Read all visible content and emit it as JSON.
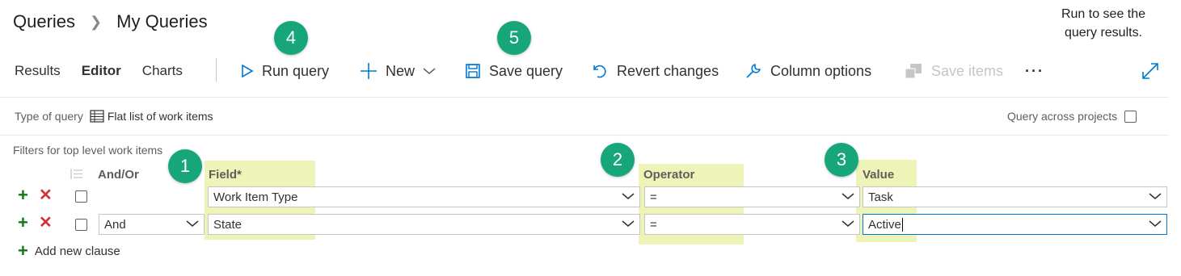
{
  "breadcrumb": {
    "root": "Queries",
    "current": "My Queries"
  },
  "hint": {
    "line1": "Run to see the",
    "line2": "query results."
  },
  "tabs": [
    "Results",
    "Editor",
    "Charts"
  ],
  "toolbar": {
    "run": "Run query",
    "new": "New",
    "save": "Save query",
    "revert": "Revert changes",
    "columns": "Column options",
    "save_items": "Save items",
    "more": "···"
  },
  "query_type": {
    "label": "Type of query",
    "value": "Flat list of work items"
  },
  "query_across": "Query across projects",
  "filters_label": "Filters for top level work items",
  "columns": {
    "andor": "And/Or",
    "field": "Field*",
    "operator": "Operator",
    "value": "Value"
  },
  "rows": [
    {
      "andor": "",
      "field": "Work Item Type",
      "operator": "=",
      "value": "Task"
    },
    {
      "andor": "And",
      "field": "State",
      "operator": "=",
      "value": "Active"
    }
  ],
  "add_clause": "Add new clause",
  "badges": [
    "1",
    "2",
    "3",
    "4",
    "5"
  ],
  "colors": {
    "accent": "#0078d4",
    "badge": "#17a67a",
    "highlight": "#eef3b8",
    "add": "#107c10",
    "remove": "#d13438"
  }
}
